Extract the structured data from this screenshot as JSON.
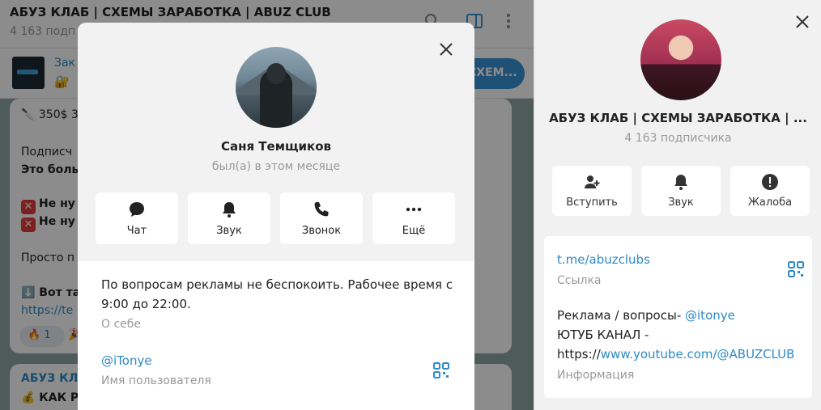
{
  "chat": {
    "title": "АБУЗ КЛАБ | СХЕМЫ ЗАРАБОТКА | ABUZ CLUB",
    "subscribers": "4 163 подп",
    "pinned": {
      "title": "Зак",
      "emoji": "🔐",
      "button_label": "СХЕМ..."
    },
    "messages": [
      {
        "lines": [
          "🔪 350$ 3",
          "Подписч",
          "Это боль",
          "Не ну",
          "Не ну",
          "Просто п",
          "⬇️ Вот та",
          "https://te"
        ],
        "reaction_emoji": "🔥",
        "reaction_count": "1",
        "extra_emoji": "🎉"
      },
      {
        "sender": "АБУЗ КЛА",
        "line": "💰 КАК Р"
      }
    ],
    "red_mark": "✕"
  },
  "modal": {
    "name": "Саня Темщиков",
    "status": "был(а) в этом месяце",
    "actions": [
      {
        "label": "Чат",
        "icon": "chat-icon"
      },
      {
        "label": "Звук",
        "icon": "bell-icon"
      },
      {
        "label": "Звонок",
        "icon": "phone-icon"
      },
      {
        "label": "Ещё",
        "icon": "more-icon"
      }
    ],
    "bio_line1": "По вопросам рекламы не беспокоить. Рабочее время с",
    "bio_line2": "9:00 до 22:00.",
    "bio_caption": "О себе",
    "username": "@iTonye",
    "username_caption": "Имя пользователя"
  },
  "info_panel": {
    "title": "АБУЗ КЛАБ | СХЕМЫ ЗАРАБОТКА | ...",
    "subscribers": "4 163 подписчика",
    "actions": [
      {
        "label": "Вступить",
        "icon": "add-user-icon"
      },
      {
        "label": "Звук",
        "icon": "bell-icon"
      },
      {
        "label": "Жалоба",
        "icon": "report-icon"
      }
    ],
    "link": "t.me/abuzclubs",
    "link_caption": "Ссылка",
    "info_line1_text": "Реклама / вопросы- ",
    "info_line1_link": "@itonye",
    "info_line2": "ЮТУБ КАНАЛ -",
    "info_line3_text": "https://",
    "info_line3_link": "www.youtube.com/@ABUZCLUB",
    "info_caption": "Информация"
  },
  "colors": {
    "accent": "#2e8ac7",
    "button_blue": "#3a93d6",
    "chat_bg": "#8da8a0"
  }
}
